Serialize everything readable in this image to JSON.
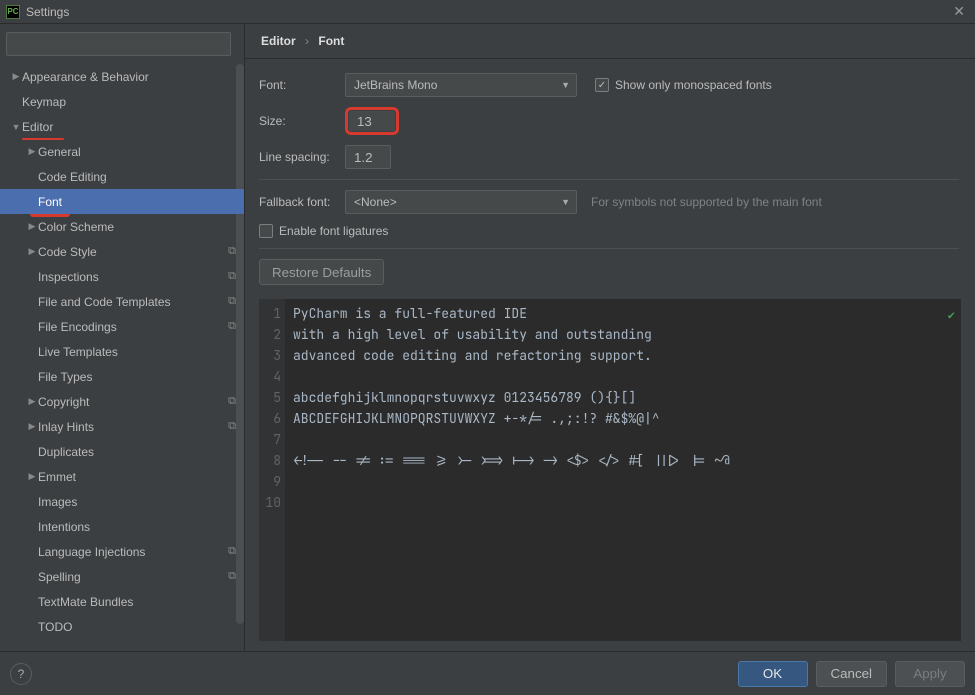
{
  "window": {
    "title": "Settings"
  },
  "breadcrumb": {
    "a": "Editor",
    "b": "Font"
  },
  "search": {
    "placeholder": ""
  },
  "tree": {
    "items": [
      {
        "label": "Appearance & Behavior",
        "lv": 0,
        "arrow": "▶",
        "copy": false
      },
      {
        "label": "Keymap",
        "lv": 0,
        "arrow": "",
        "copy": false
      },
      {
        "label": "Editor",
        "lv": 0,
        "arrow": "▼",
        "copy": false,
        "redline": true
      },
      {
        "label": "General",
        "lv": 1,
        "arrow": "▶",
        "copy": false
      },
      {
        "label": "Code Editing",
        "lv": 1,
        "arrow": "",
        "copy": false
      },
      {
        "label": "Font",
        "lv": 1,
        "arrow": "",
        "copy": false,
        "selected": true,
        "redcurl": true
      },
      {
        "label": "Color Scheme",
        "lv": 1,
        "arrow": "▶",
        "copy": false
      },
      {
        "label": "Code Style",
        "lv": 1,
        "arrow": "▶",
        "copy": true
      },
      {
        "label": "Inspections",
        "lv": 1,
        "arrow": "",
        "copy": true
      },
      {
        "label": "File and Code Templates",
        "lv": 1,
        "arrow": "",
        "copy": true
      },
      {
        "label": "File Encodings",
        "lv": 1,
        "arrow": "",
        "copy": true
      },
      {
        "label": "Live Templates",
        "lv": 1,
        "arrow": "",
        "copy": false
      },
      {
        "label": "File Types",
        "lv": 1,
        "arrow": "",
        "copy": false
      },
      {
        "label": "Copyright",
        "lv": 1,
        "arrow": "▶",
        "copy": true
      },
      {
        "label": "Inlay Hints",
        "lv": 1,
        "arrow": "▶",
        "copy": true
      },
      {
        "label": "Duplicates",
        "lv": 1,
        "arrow": "",
        "copy": false
      },
      {
        "label": "Emmet",
        "lv": 1,
        "arrow": "▶",
        "copy": false
      },
      {
        "label": "Images",
        "lv": 1,
        "arrow": "",
        "copy": false
      },
      {
        "label": "Intentions",
        "lv": 1,
        "arrow": "",
        "copy": false
      },
      {
        "label": "Language Injections",
        "lv": 1,
        "arrow": "",
        "copy": true
      },
      {
        "label": "Spelling",
        "lv": 1,
        "arrow": "",
        "copy": true
      },
      {
        "label": "TextMate Bundles",
        "lv": 1,
        "arrow": "",
        "copy": false
      },
      {
        "label": "TODO",
        "lv": 1,
        "arrow": "",
        "copy": false
      }
    ]
  },
  "form": {
    "font_label": "Font:",
    "font_value": "JetBrains Mono",
    "show_mono_label": "Show only monospaced fonts",
    "size_label": "Size:",
    "size_value": "13",
    "spacing_label": "Line spacing:",
    "spacing_value": "1.2",
    "fallback_label": "Fallback font:",
    "fallback_value": "<None>",
    "fallback_hint": "For symbols not supported by the main font",
    "ligatures_label": "Enable font ligatures",
    "restore_label": "Restore Defaults"
  },
  "preview": {
    "lines": [
      "PyCharm is a full-featured IDE",
      "with a high level of usability and outstanding",
      "advanced code editing and refactoring support.",
      "",
      "abcdefghijklmnopqrstuvwxyz 0123456789 (){}[]",
      "ABCDEFGHIJKLMNOPQRSTUVWXYZ +-*/= .,;:!? #&$%@|^",
      "",
      "<!-- -- != := === >= >- >=> |-> -> <$> </> #[ |||> |= ~@",
      "",
      ""
    ]
  },
  "footer": {
    "ok": "OK",
    "cancel": "Cancel",
    "apply": "Apply"
  }
}
